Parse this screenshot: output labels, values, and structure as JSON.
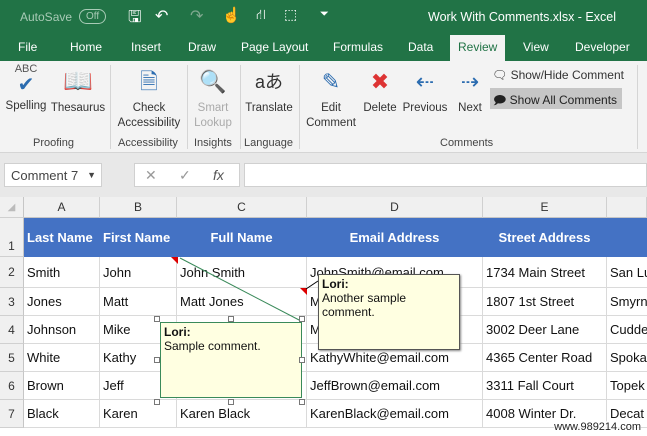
{
  "title_bar": {
    "autosave_label": "AutoSave",
    "autosave_state": "Off",
    "title": "Work With Comments.xlsx  -  Excel"
  },
  "tabs": [
    "File",
    "Home",
    "Insert",
    "Draw",
    "Page Layout",
    "Formulas",
    "Data",
    "Review",
    "View",
    "Developer"
  ],
  "active_tab": "Review",
  "ribbon": {
    "spelling": "Spelling",
    "abc": "ABC",
    "thesaurus": "Thesaurus",
    "proofing": "Proofing",
    "check": "Check",
    "accessibility_btn": "Accessibility",
    "accessibility": "Accessibility",
    "smart": "Smart",
    "lookup": "Lookup",
    "insights": "Insights",
    "translate": "Translate",
    "language": "Language",
    "edit": "Edit",
    "comment": "Comment",
    "delete": "Delete",
    "previous": "Previous",
    "next": "Next",
    "show_hide": "Show/Hide Comment",
    "show_all": "Show All Comments",
    "comments": "Comments"
  },
  "formula_bar": {
    "name_box": "Comment 7",
    "value": ""
  },
  "columns": [
    "A",
    "B",
    "C",
    "D",
    "E"
  ],
  "rows": [
    "1",
    "2",
    "3",
    "4",
    "5",
    "6",
    "7"
  ],
  "header_row": [
    "Last Name",
    "First Name",
    "Full Name",
    "Email Address",
    "Street Address"
  ],
  "data_rows": [
    [
      "Smith",
      "John",
      "John Smith",
      "JohnSmith@email.com",
      "1734 Main Street",
      "San Lu"
    ],
    [
      "Jones",
      "Matt",
      "Matt Jones",
      "MattJones@email.com",
      "1807 1st Street",
      "Smyrn"
    ],
    [
      "Johnson",
      "Mike",
      "",
      "MikeJohnson@email.com",
      "3002 Deer Lane",
      "Cudde"
    ],
    [
      "White",
      "Kathy",
      "",
      "KathyWhite@email.com",
      "4365 Center Road",
      "Spoka"
    ],
    [
      "Brown",
      "Jeff",
      "",
      "JeffBrown@email.com",
      "3311 Fall Court",
      "Topek"
    ],
    [
      "Black",
      "Karen",
      "Karen Black",
      "KarenBlack@email.com",
      "4008 Winter Dr.",
      "Decat"
    ]
  ],
  "comments": [
    {
      "author": "Lori:",
      "text": "Sample comment."
    },
    {
      "author": "Lori:",
      "text": "Another sample comment."
    }
  ],
  "watermark": "www.989214.com",
  "colors": {
    "excel_green": "#217346",
    "header_blue": "#4472c4",
    "comment_bg": "#ffffe1"
  }
}
